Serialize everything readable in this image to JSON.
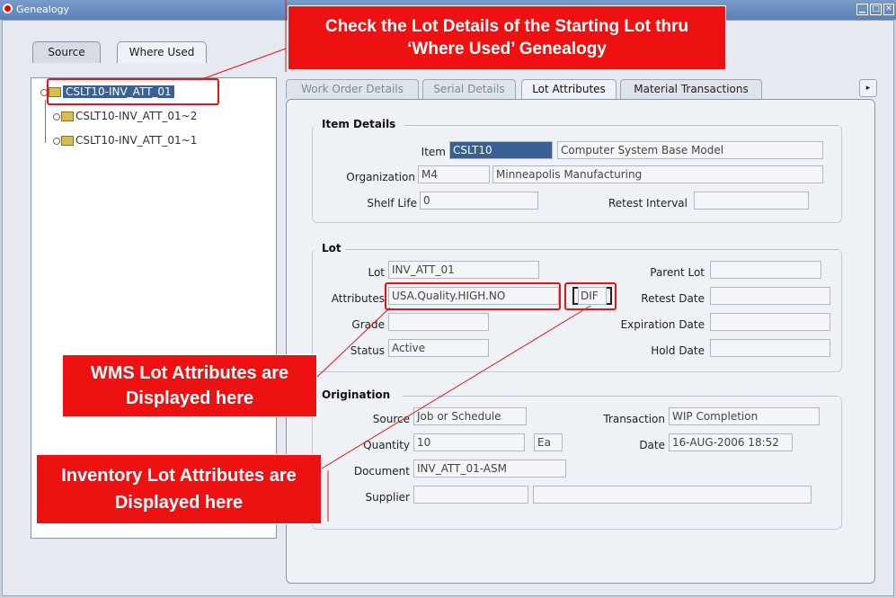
{
  "window": {
    "title": "Genealogy"
  },
  "left_tabs": [
    {
      "label": "Source"
    },
    {
      "label": "Where Used"
    }
  ],
  "tree": {
    "root": "CSLT10-INV_ATT_01",
    "children": [
      "CSLT10-INV_ATT_01~2",
      "CSLT10-INV_ATT_01~1"
    ]
  },
  "right_tabs": [
    {
      "label": "Work Order Details"
    },
    {
      "label": "Serial Details"
    },
    {
      "label": "Lot Attributes"
    },
    {
      "label": "Material Transactions"
    }
  ],
  "scroll_arrow": "▸",
  "item_details": {
    "title": "Item Details",
    "item_label": "Item",
    "item_value": "CSLT10",
    "item_desc": "Computer System Base Model",
    "org_label": "Organization",
    "org_code": "M4",
    "org_name": "Minneapolis Manufacturing",
    "shelf_label": "Shelf Life",
    "shelf_value": "0",
    "retest_interval_label": "Retest Interval",
    "retest_interval_value": ""
  },
  "lot": {
    "title": "Lot",
    "lot_label": "Lot",
    "lot_value": "INV_ATT_01",
    "attributes_label": "Attributes",
    "attributes_value": "USA.Quality.HIGH.NO",
    "dff_value": "DIF",
    "grade_label": "Grade",
    "grade_value": "",
    "status_label": "Status",
    "status_value": "Active",
    "parent_lot_label": "Parent Lot",
    "parent_lot_value": "",
    "retest_date_label": "Retest Date",
    "retest_date_value": "",
    "expiration_label": "Expiration Date",
    "expiration_value": "",
    "hold_label": "Hold Date",
    "hold_value": ""
  },
  "origination": {
    "title": "Origination",
    "source_label": "Source",
    "source_value": "Job or Schedule",
    "quantity_label": "Quantity",
    "quantity_value": "10",
    "uom_value": "Ea",
    "document_label": "Document",
    "document_value": "INV_ATT_01-ASM",
    "supplier_label": "Supplier",
    "supplier_value": "",
    "supplier_name": "",
    "transaction_label": "Transaction",
    "transaction_value": "WIP Completion",
    "date_label": "Date",
    "date_value": "16-AUG-2006 18:52"
  },
  "callouts": {
    "top": "Check the Lot Details of the Starting Lot thru ‘Where Used’ Genealogy",
    "wms": "WMS Lot Attributes are Displayed here",
    "inventory": "Inventory Lot Attributes are Displayed here"
  },
  "colors": {
    "callout_red": "#ee1111",
    "selection_blue": "#3a5f96",
    "titlebar_blue": "#5a80b6"
  }
}
